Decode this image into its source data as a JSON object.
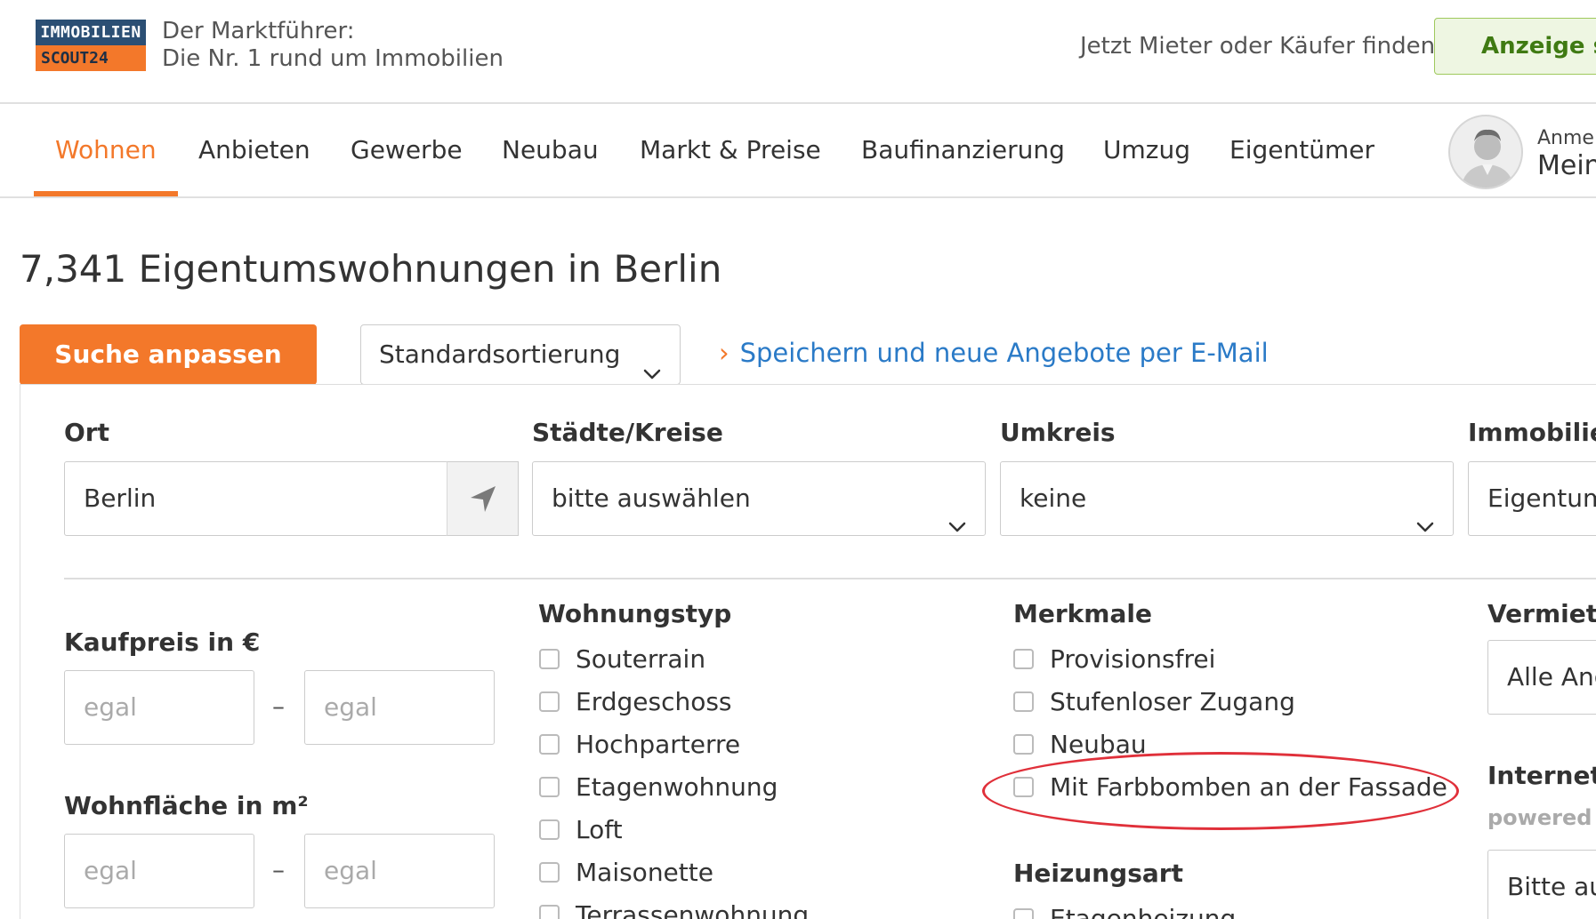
{
  "header": {
    "logo_top": "IMMOBILIEN",
    "logo_bottom": "SCOUT24",
    "tagline_line1": "Der Marktführer:",
    "tagline_line2": "Die Nr. 1 rund um Immobilien",
    "find_link": "Jetzt Mieter oder Käufer finden",
    "ad_button": "Anzeige sc"
  },
  "nav": {
    "items": [
      "Wohnen",
      "Anbieten",
      "Gewerbe",
      "Neubau",
      "Markt & Preise",
      "Baufinanzierung",
      "Umzug",
      "Eigentümer"
    ],
    "active": "Wohnen",
    "login_small": "Anmeld",
    "login_big": "Mein"
  },
  "results": {
    "count": "7,341",
    "label": "Eigentumswohnungen in Berlin"
  },
  "actions": {
    "search_button": "Suche anpassen",
    "sort_value": "Standardsortierung",
    "save_link": "Speichern und neue Angebote per E-Mail"
  },
  "filters": {
    "ort_label": "Ort",
    "ort_value": "Berlin",
    "staedte_label": "Städte/Kreise",
    "staedte_value": "bitte auswählen",
    "umkreis_label": "Umkreis",
    "umkreis_value": "keine",
    "immobilien_label": "Immobilien",
    "immobilien_value": "Eigentum",
    "kaufpreis_label": "Kaufpreis in €",
    "kaufpreis_from": "egal",
    "kaufpreis_to": "egal",
    "wohnflaeche_label": "Wohnfläche in m²",
    "wohnflaeche_from": "egal",
    "wohnflaeche_to": "egal",
    "range_dash": "–",
    "wohnungstyp_label": "Wohnungstyp",
    "wohnungstyp_options": [
      "Souterrain",
      "Erdgeschoss",
      "Hochparterre",
      "Etagenwohnung",
      "Loft",
      "Maisonette",
      "Terrassenwohnung"
    ],
    "merkmale_label": "Merkmale",
    "merkmale_options": [
      "Provisionsfrei",
      "Stufenloser Zugang",
      "Neubau",
      "Mit Farbbomben an der Fassade"
    ],
    "heizungsart_label": "Heizungsart",
    "heizungsart_options": [
      "Etagenheizung"
    ],
    "vermietung_label": "Vermietu",
    "vermietung_value": "Alle Ang",
    "internet_label": "Internet-V",
    "powered_text": "powered b",
    "internet_value": "Bitte au"
  },
  "colors": {
    "accent": "#f3782a",
    "link": "#2a7ac7",
    "highlight": "#e0303a",
    "logo_blue": "#2b4f74"
  }
}
